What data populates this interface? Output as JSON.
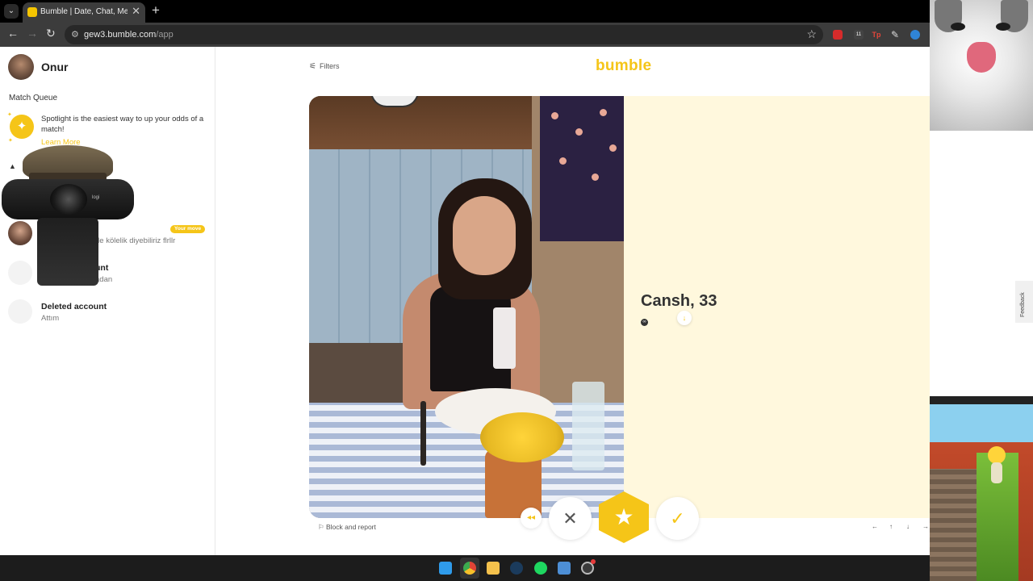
{
  "browser": {
    "tab_title": "Bumble | Date, Chat, Meet New",
    "tab_close": "✕",
    "new_tab": "+",
    "url_host": "gew3.bumble.com",
    "url_path": "/app",
    "ext_badge": "11",
    "ext_tp": "Tp"
  },
  "sidebar": {
    "user_name": "Onur",
    "match_queue_title": "Match Queue",
    "spotlight_text": "Spotlight is the easiest way to up your odds of a match!",
    "spotlight_link": "Learn More",
    "conversations": [
      {
        "message": "de kölelik diyebiliriz flrllr",
        "badge": "Your move"
      },
      {
        "name": "unt",
        "message": "adan"
      },
      {
        "name": "Deleted account",
        "message": "Attım"
      }
    ]
  },
  "webcam": {
    "logo": "logi"
  },
  "main": {
    "filters_label": "Filters",
    "logo": "bumble",
    "profile": {
      "name_age": "Cansh, 33"
    },
    "block_report": "Block and report",
    "pager": [
      "←",
      "↑",
      "↓",
      "→"
    ]
  },
  "feedback_label": "Feedback",
  "colors": {
    "brand": "#f5c518",
    "info_panel": "#fff8dd"
  },
  "icons": {
    "rewind": "rewind-icon",
    "pass": "close-icon",
    "superswipe": "star-icon",
    "like": "check-icon"
  }
}
